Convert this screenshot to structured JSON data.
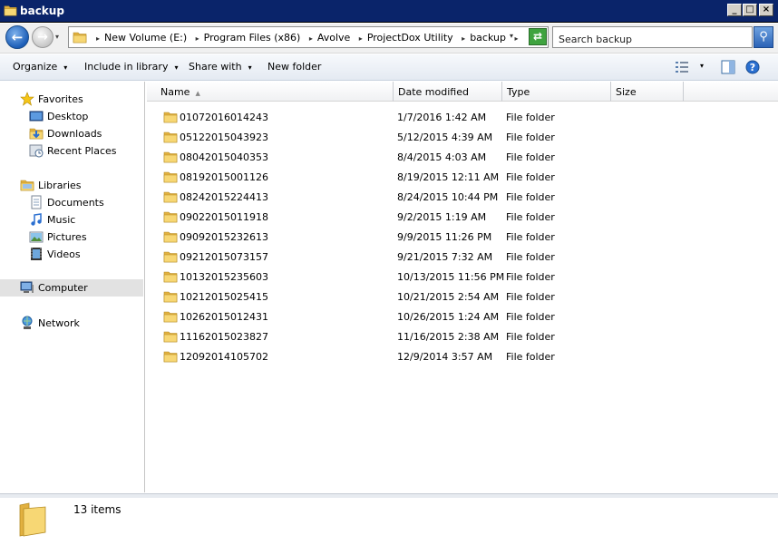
{
  "window": {
    "title": "backup"
  },
  "address": {
    "crumbs": [
      "New Volume (E:)",
      "Program Files (x86)",
      "Avolve",
      "ProjectDox Utility",
      "backup"
    ],
    "arrow_glyph": "▸",
    "dropdown_glyph": "▾"
  },
  "search": {
    "placeholder": "Search backup"
  },
  "toolbar": {
    "organize": "Organize",
    "include_in_library": "Include in library",
    "share_with": "Share with",
    "new_folder": "New folder"
  },
  "navigation": {
    "favorites": {
      "label": "Favorites",
      "items": [
        "Desktop",
        "Downloads",
        "Recent Places"
      ]
    },
    "libraries": {
      "label": "Libraries",
      "items": [
        "Documents",
        "Music",
        "Pictures",
        "Videos"
      ]
    },
    "computer": "Computer",
    "network": "Network",
    "selected": "Computer"
  },
  "columns": {
    "name": "Name",
    "date": "Date modified",
    "type": "Type",
    "size": "Size"
  },
  "files": [
    {
      "name": "01072016014243",
      "date": "1/7/2016 1:42 AM",
      "type": "File folder"
    },
    {
      "name": "05122015043923",
      "date": "5/12/2015 4:39 AM",
      "type": "File folder"
    },
    {
      "name": "08042015040353",
      "date": "8/4/2015 4:03 AM",
      "type": "File folder"
    },
    {
      "name": "08192015001126",
      "date": "8/19/2015 12:11 AM",
      "type": "File folder"
    },
    {
      "name": "08242015224413",
      "date": "8/24/2015 10:44 PM",
      "type": "File folder"
    },
    {
      "name": "09022015011918",
      "date": "9/2/2015 1:19 AM",
      "type": "File folder"
    },
    {
      "name": "09092015232613",
      "date": "9/9/2015 11:26 PM",
      "type": "File folder"
    },
    {
      "name": "09212015073157",
      "date": "9/21/2015 7:32 AM",
      "type": "File folder"
    },
    {
      "name": "10132015235603",
      "date": "10/13/2015 11:56 PM",
      "type": "File folder"
    },
    {
      "name": "10212015025415",
      "date": "10/21/2015 2:54 AM",
      "type": "File folder"
    },
    {
      "name": "10262015012431",
      "date": "10/26/2015 1:24 AM",
      "type": "File folder"
    },
    {
      "name": "11162015023827",
      "date": "11/16/2015 2:38 AM",
      "type": "File folder"
    },
    {
      "name": "12092014105702",
      "date": "12/9/2014 3:57 AM",
      "type": "File folder"
    }
  ],
  "status": {
    "item_count": "13 items"
  },
  "icons": {
    "folder": "folder-icon",
    "star": "star-icon",
    "desktop": "desktop-icon",
    "downloads": "downloads-icon",
    "recent": "recent-places-icon",
    "libraries": "libraries-icon",
    "documents": "documents-icon",
    "music": "music-icon",
    "pictures": "pictures-icon",
    "videos": "videos-icon",
    "computer": "computer-icon",
    "network": "network-icon"
  },
  "colors": {
    "title_bar": "#0a246a",
    "selection": "#e2e2e2",
    "folder": "#f2c94c"
  }
}
